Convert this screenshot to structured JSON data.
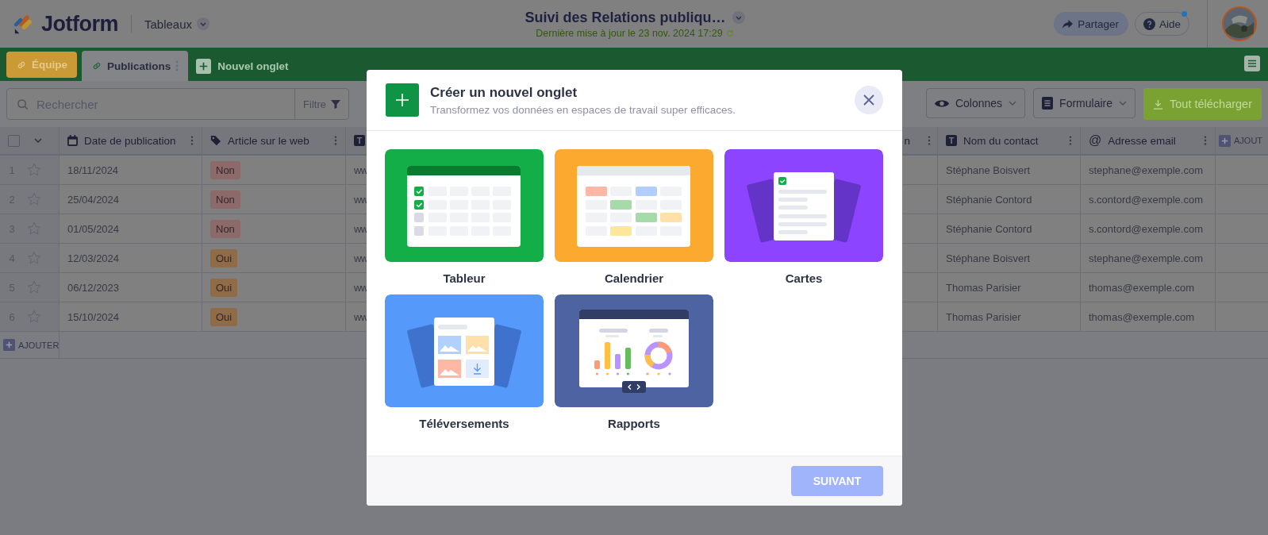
{
  "header": {
    "brand": "Jotform",
    "workspace_menu": "Tableaux",
    "title": "Suivi des Relations publiqu…",
    "last_updated": "Dernière mise à jour le 23 nov. 2024 17:29",
    "share_button": "Partager",
    "help_button": {
      "label": "Aide",
      "notification": true
    }
  },
  "tabs": [
    {
      "label": "Équipe",
      "selected": false
    },
    {
      "label": "Publications",
      "selected": true
    }
  ],
  "new_tab_button": "Nouvel onglet",
  "toolbar": {
    "search": {
      "placeholder": "Rechercher"
    },
    "filter_button": "Filtre",
    "columns_button": "Colonnes",
    "form_button": "Formulaire",
    "download_button": "Tout télécharger"
  },
  "table": {
    "select_all": {
      "checked": false
    },
    "columns": [
      {
        "kind": "date",
        "title": "Date de publication",
        "menu": true
      },
      {
        "kind": "tag",
        "title": "Article sur le web",
        "menu": true
      },
      {
        "kind": "text",
        "glyph": "T",
        "menu": false
      },
      {
        "kind": "plain",
        "title": "n",
        "menu": true
      },
      {
        "kind": "text",
        "glyph": "T",
        "title": "Nom du contact",
        "menu": true
      },
      {
        "kind": "email",
        "glyph": "@",
        "title": "Adresse email",
        "menu": true
      }
    ],
    "add_column": "AJOUT",
    "rows": [
      {
        "number": "1",
        "starred": false,
        "date": "18/11/2024",
        "article": {
          "text": "Non",
          "color": "#8c6a6a"
        },
        "column_3": "ww",
        "contact": "Stéphane Boisvert",
        "email": "stephane@exemple.com"
      },
      {
        "number": "2",
        "starred": false,
        "date": "25/04/2024",
        "article": {
          "text": "Non",
          "color": "#8c6a6a"
        },
        "column_3": "ww",
        "contact": "Stéphanie Contord",
        "email": "s.contord@exemple.com"
      },
      {
        "number": "3",
        "starred": false,
        "date": "01/05/2024",
        "article": {
          "text": "Non",
          "color": "#8c6a6a"
        },
        "column_3": "ww",
        "contact": "Stéphanie Contord",
        "email": "s.contord@exemple.com"
      },
      {
        "number": "4",
        "starred": false,
        "date": "12/03/2024",
        "article": {
          "text": "Oui",
          "color": "#8f6b48"
        },
        "column_3": "ww",
        "contact": "Stéphane Boisvert",
        "email": "stephane@exemple.com"
      },
      {
        "number": "5",
        "starred": false,
        "date": "06/12/2023",
        "article": {
          "text": "Oui",
          "color": "#8f6b48"
        },
        "column_3": "ww",
        "contact": "Thomas Parisier",
        "email": "thomas@exemple.com"
      },
      {
        "number": "6",
        "starred": false,
        "date": "15/10/2024",
        "article": {
          "text": "Oui",
          "color": "#8f6b48"
        },
        "column_3": "ww",
        "contact": "Thomas Parisier",
        "email": "thomas@exemple.com"
      }
    ],
    "add_row": "AJOUTER"
  },
  "modal": {
    "title": "Créer un nouvel onglet",
    "subtitle": "Transformez vos données en espaces de travail super efficaces.",
    "options": [
      {
        "kind": "spreadsheet",
        "label": "Tableur",
        "selected": false
      },
      {
        "kind": "calendar",
        "label": "Calendrier",
        "selected": false
      },
      {
        "kind": "cards",
        "label": "Cartes",
        "selected": false
      },
      {
        "kind": "uploads",
        "label": "Téléversements",
        "selected": false
      },
      {
        "kind": "report",
        "label": "Rapports",
        "selected": false
      }
    ],
    "next_button": {
      "label": "SUIVANT",
      "disabled": true
    }
  }
}
